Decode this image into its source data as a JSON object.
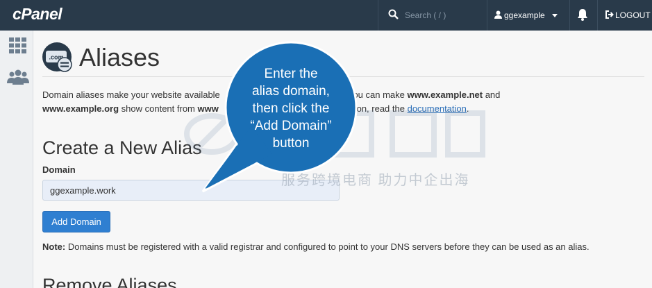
{
  "topbar": {
    "logo": "cPanel",
    "search_placeholder": "Search ( / )",
    "username": "ggexample",
    "logout_label": "LOGOUT"
  },
  "page": {
    "title": "Aliases",
    "description_part1": "Domain aliases make your website available ",
    "description_part2": "or example, you can make ",
    "example_net": "www.example.net",
    "description_and": " and",
    "example_org": "www.example.org",
    "description_part3": " show content from ",
    "example_com_partial": "www",
    "description_part4": "ation, read the ",
    "doc_link": "documentation",
    "period": "."
  },
  "create": {
    "title": "Create a New Alias",
    "domain_label": "Domain",
    "domain_value": "ggexample.work",
    "add_button": "Add Domain"
  },
  "note": {
    "label": "Note:",
    "text": " Domains must be registered with a valid registrar and configured to point to your DNS servers before they can be used as an alias."
  },
  "remove": {
    "title": "Remove Aliases"
  },
  "callout": {
    "line1": "Enter the",
    "line2": "alias domain,",
    "line3": "then click the",
    "line4": "“Add Domain”",
    "line5": "button",
    "color": "#1a6fb5"
  },
  "watermark": {
    "text": "服务跨境电商 助力中企出海"
  },
  "icons": {
    "search": "search-icon",
    "user": "user-icon",
    "bell": "bell-icon",
    "logout": "logout-icon",
    "grid": "grid-icon",
    "users": "users-icon",
    "page": "domain-alias-icon"
  }
}
